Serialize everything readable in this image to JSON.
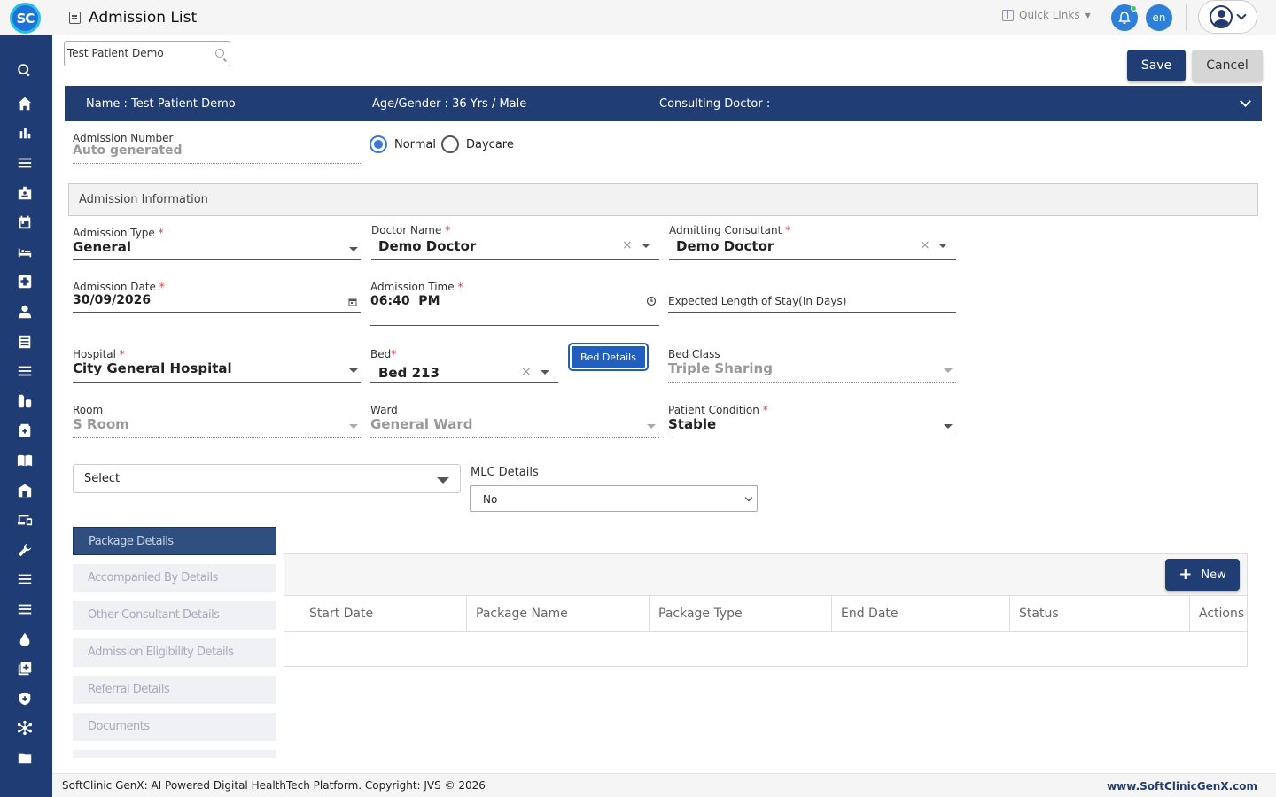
{
  "app": {
    "logo_text": "SC",
    "page_title": "Admission List",
    "quick_links": "Quick Links",
    "language": "en"
  },
  "colors": {
    "primary": "#203d74",
    "accent": "#2e7fd8",
    "bed_button": "#1f5fbf",
    "required": "#e53935"
  },
  "sidebar": {
    "icons": [
      "search-icon",
      "home-icon",
      "bar-chart-icon",
      "menu-icon",
      "id-badge-icon",
      "calendar-icon",
      "bed-icon",
      "medical-plus-icon",
      "person-icon",
      "list-doc-icon",
      "menu-icon",
      "pharmacy-icon",
      "medicine-box-icon",
      "book-icon",
      "building-icon",
      "devices-icon",
      "wrench-icon",
      "menu-icon",
      "menu-icon",
      "blood-drop-icon",
      "add-box-icon",
      "shield-icon",
      "network-icon",
      "folder-icon"
    ]
  },
  "toolbar": {
    "search_value": "Test Patient Demo",
    "save_label": "Save",
    "cancel_label": "Cancel"
  },
  "patient_bar": {
    "name": "Name :  Test Patient Demo",
    "age_gender": "Age/Gender :  36 Yrs / Male",
    "consulting_doctor": "Consulting Doctor :"
  },
  "admission": {
    "number_label": "Admission Number",
    "number_value": "Auto generated",
    "radio_normal": "Normal",
    "radio_daycare": "Daycare",
    "selected_mode": "Normal"
  },
  "section_title": "Admission Information",
  "form": {
    "admission_type_label": "Admission Type",
    "admission_type_value": "General",
    "doctor_name_label": "Doctor Name",
    "doctor_name_value": "Demo Doctor",
    "admitting_consultant_label": "Admitting Consultant",
    "admitting_consultant_value": "Demo Doctor",
    "admission_date_label": "Admission Date",
    "admission_date_value": "30/09/2026",
    "admission_time_label": "Admission Time",
    "admission_time_value": "06:40  PM",
    "expected_stay_label": "Expected Length of Stay(In Days)",
    "hospital_label": "Hospital",
    "hospital_value": "City General Hospital",
    "bed_label": "Bed",
    "bed_value": "Bed 213",
    "bed_details_button": "Bed Details",
    "bed_class_label": "Bed Class",
    "bed_class_value": "Triple Sharing",
    "room_label": "Room",
    "room_value": "S Room",
    "ward_label": "Ward",
    "ward_value": "General Ward",
    "patient_condition_label": "Patient Condition",
    "patient_condition_value": "Stable",
    "required_mark": "*",
    "clear_mark": "×",
    "select_placeholder": "Select",
    "mlc_label": "MLC Details",
    "mlc_value": "No"
  },
  "tabs": [
    {
      "label": "Package Details",
      "active": true
    },
    {
      "label": "Accompanied By Details",
      "active": false
    },
    {
      "label": "Other Consultant Details",
      "active": false
    },
    {
      "label": "Admission Eligibility Details",
      "active": false
    },
    {
      "label": "Referral Details",
      "active": false
    },
    {
      "label": "Documents",
      "active": false
    }
  ],
  "grid": {
    "new_button": "New",
    "columns": [
      "Start Date",
      "Package Name",
      "Package Type",
      "End Date",
      "Status",
      "Actions"
    ]
  },
  "footer": {
    "copyright": "SoftClinic GenX: AI Powered Digital HealthTech Platform. Copyright: JVS © 2026",
    "website": "www.SoftClinicGenX.com"
  }
}
